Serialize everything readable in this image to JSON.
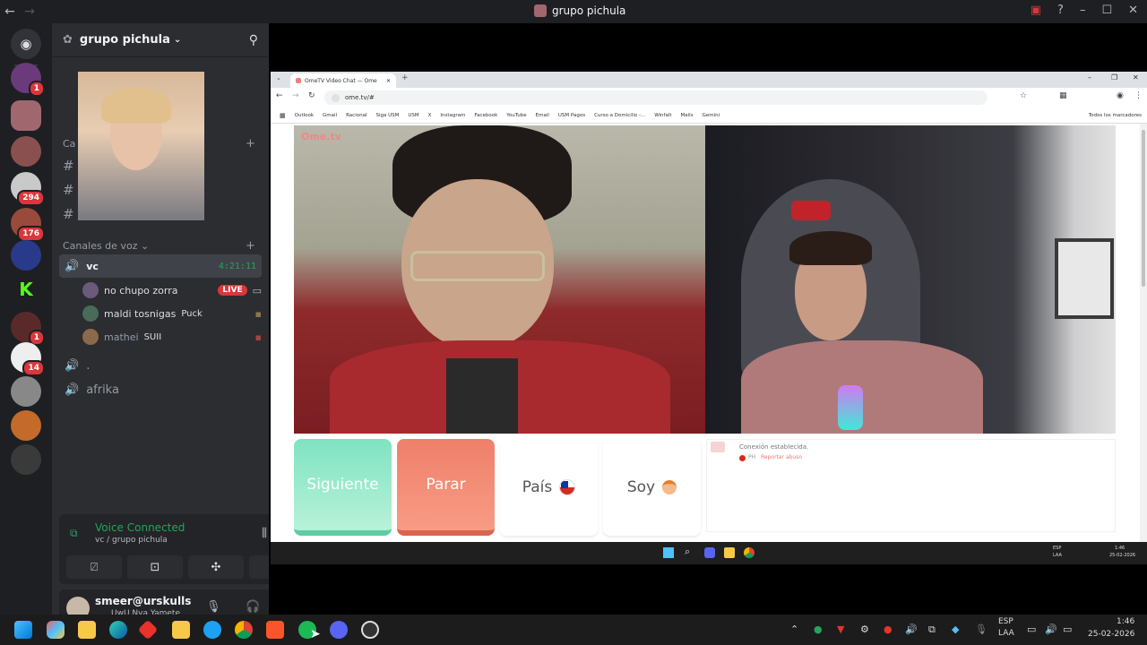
{
  "window": {
    "title": "grupo pichula"
  },
  "server": {
    "name": "grupo pichula",
    "badges": [
      "1",
      "294",
      "176",
      "1",
      "14"
    ]
  },
  "channels": {
    "cat_text_partial": "Ca",
    "cat_voice": "Canales de voz",
    "voice": [
      {
        "name": "vc",
        "timer": "4:21:11"
      },
      {
        "name": "."
      },
      {
        "name": "afrika"
      }
    ],
    "vc_users": [
      {
        "name": "no chupo zorra",
        "tag": "LIVE"
      },
      {
        "name": "maldi tosnigas",
        "tag": "Puck"
      },
      {
        "name": "mathei",
        "tag": "SUII"
      }
    ]
  },
  "voice_panel": {
    "status": "Voice Connected",
    "location": "vc / grupo pichula"
  },
  "user_panel": {
    "username": "smeer@urskulls",
    "status": "UwU Nya Yamete"
  },
  "browser": {
    "tab_title": "OmeTV Video Chat — Ome",
    "url": "ome.tv/#",
    "bookmarks": [
      "Outlook",
      "Gmail",
      "Racional",
      "Siga USM",
      "USM",
      "X",
      "Instagram",
      "Facebook",
      "YouTube",
      "Email",
      "USM Pagos",
      "Curso a Domicilio -...",
      "Winfalt",
      "Mails",
      "Gemini"
    ],
    "bookmarks_right": "Todos los marcadores"
  },
  "ometv": {
    "logo": "Ome.tv",
    "next_label": "Siguiente",
    "stop_label": "Parar",
    "country_label": "País",
    "me_label": "Soy",
    "chat_status": "Conexión establecida.",
    "chat_report": "Reportar abuso",
    "chat_country_code": "PH"
  },
  "inner_tray": {
    "lang": "ESP",
    "lang2": "LAA",
    "time": "1:46",
    "date": "25-02-2026"
  },
  "tray": {
    "lang": "ESP",
    "lang2": "LAA",
    "time": "1:46",
    "date": "25-02-2026"
  },
  "colors": {
    "discord_bg": "#2b2d31",
    "discord_rail": "#1e1f22",
    "next_green": "#7ee3c1",
    "stop_red": "#ef7f69",
    "voice_green": "#23a55a"
  }
}
